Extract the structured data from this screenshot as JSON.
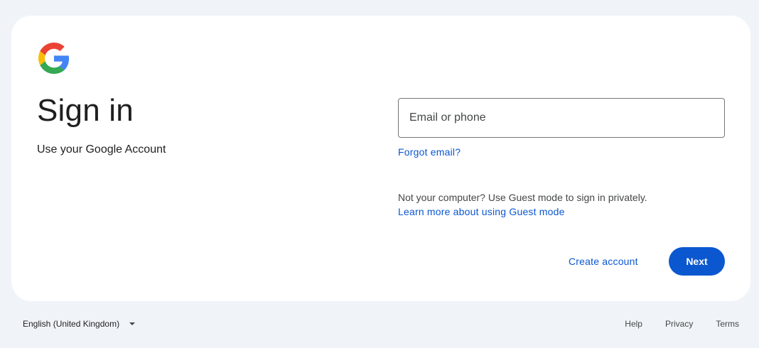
{
  "logo": {
    "icon": "google-g-icon",
    "colors": [
      "#4285F4",
      "#34A853",
      "#FBBC05",
      "#EA4335"
    ]
  },
  "heading": {
    "title": "Sign in",
    "subtitle": "Use your Google Account"
  },
  "form": {
    "email_placeholder": "Email or phone",
    "email_value": "",
    "forgot_email": "Forgot email?",
    "guest_notice": "Not your computer? Use Guest mode to sign in privately.",
    "guest_link": "Learn more about using Guest mode"
  },
  "actions": {
    "create_account": "Create account",
    "next": "Next"
  },
  "footer": {
    "language": "English (United Kingdom)",
    "links": [
      "Help",
      "Privacy",
      "Terms"
    ]
  },
  "colors": {
    "page_background": "#f0f4f9",
    "accent": "#0b57d0",
    "text": "#1f1f1f"
  }
}
